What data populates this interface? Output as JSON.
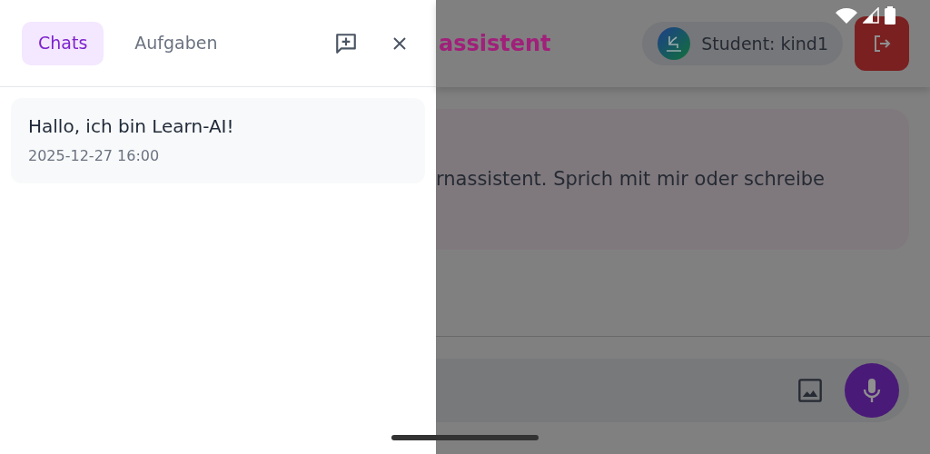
{
  "drawer": {
    "tabs": [
      {
        "label": "Chats",
        "selected": true
      },
      {
        "label": "Aufgaben",
        "selected": false
      }
    ],
    "chats": [
      {
        "title": "Hallo, ich bin Learn-AI!",
        "time": "2025-12-27 16:00"
      }
    ]
  },
  "app": {
    "title": "assistent",
    "user": "Student: kind1",
    "message": "rnassistent. Sprich mit mir oder schreibe"
  }
}
